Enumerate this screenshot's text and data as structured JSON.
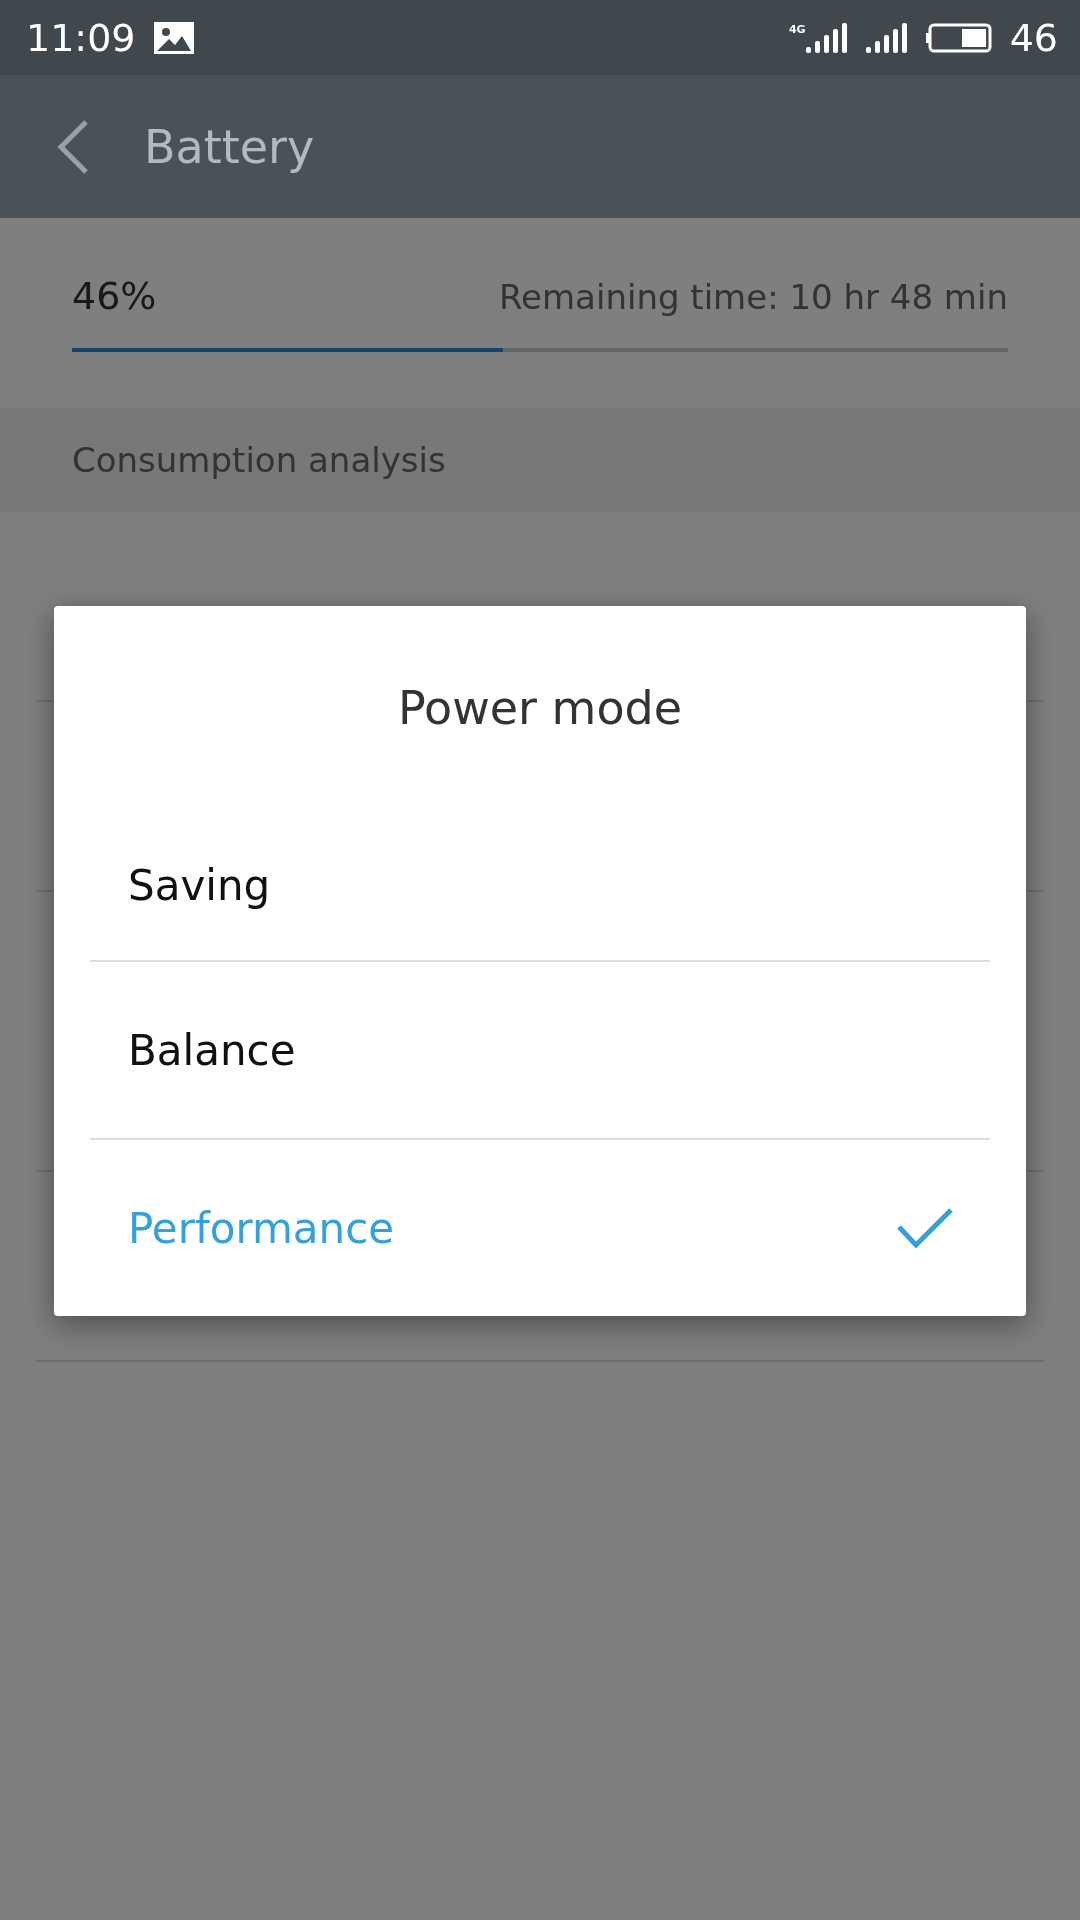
{
  "status_bar": {
    "time": "11:09",
    "network": "4G",
    "battery": "46"
  },
  "app_bar": {
    "title": "Battery"
  },
  "battery": {
    "percent": "46%",
    "remaining": "Remaining time: 10 hr 48 min",
    "level": 0.46
  },
  "section": {
    "title": "Consumption analysis"
  },
  "dialog": {
    "title": "Power mode",
    "options": [
      {
        "label": "Saving",
        "selected": false
      },
      {
        "label": "Balance",
        "selected": false
      },
      {
        "label": "Performance",
        "selected": true
      }
    ]
  }
}
